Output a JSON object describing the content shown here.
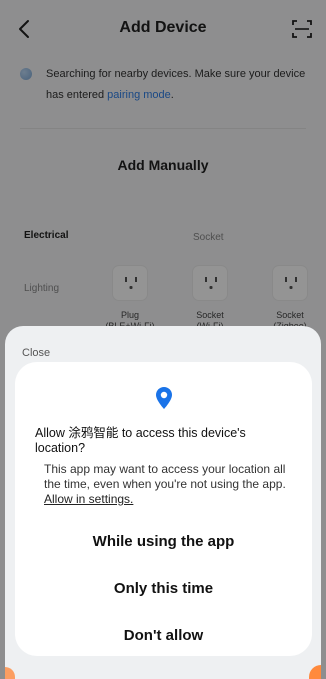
{
  "header": {
    "title": "Add Device",
    "back_icon": "chevron-left-icon",
    "scan_icon": "scan-icon"
  },
  "hint": {
    "text": "Searching for nearby devices. Make sure your device has entered",
    "link": "pairing mode",
    "tail": "."
  },
  "add_manually": "Add Manually",
  "categories": [
    {
      "label": "Electrical",
      "selected": true
    },
    {
      "label": "Lighting",
      "selected": false
    }
  ],
  "section_label": "Socket",
  "devices": [
    {
      "line1": "Plug",
      "line2": "(BLE+Wi-Fi)"
    },
    {
      "line1": "Socket",
      "line2": "(Wi-Fi)"
    },
    {
      "line1": "Socket",
      "line2": "(Zigbee)"
    }
  ],
  "sheet": {
    "close_label": "Close"
  },
  "dialog": {
    "icon": "location-pin-icon",
    "title": "Allow 涂鸦智能 to access this device's location?",
    "body": "This app may want to access your location all the time, even when you're not using the app.",
    "body_link": "Allow in settings.",
    "choices": [
      "While using the app",
      "Only this time",
      "Don't allow"
    ]
  },
  "colors": {
    "accent_blue": "#2f7ee5",
    "location_pin": "#1a73e8",
    "accent_orange": "#ff8a3d",
    "overlay": "rgba(0,0,0,0.42)"
  }
}
